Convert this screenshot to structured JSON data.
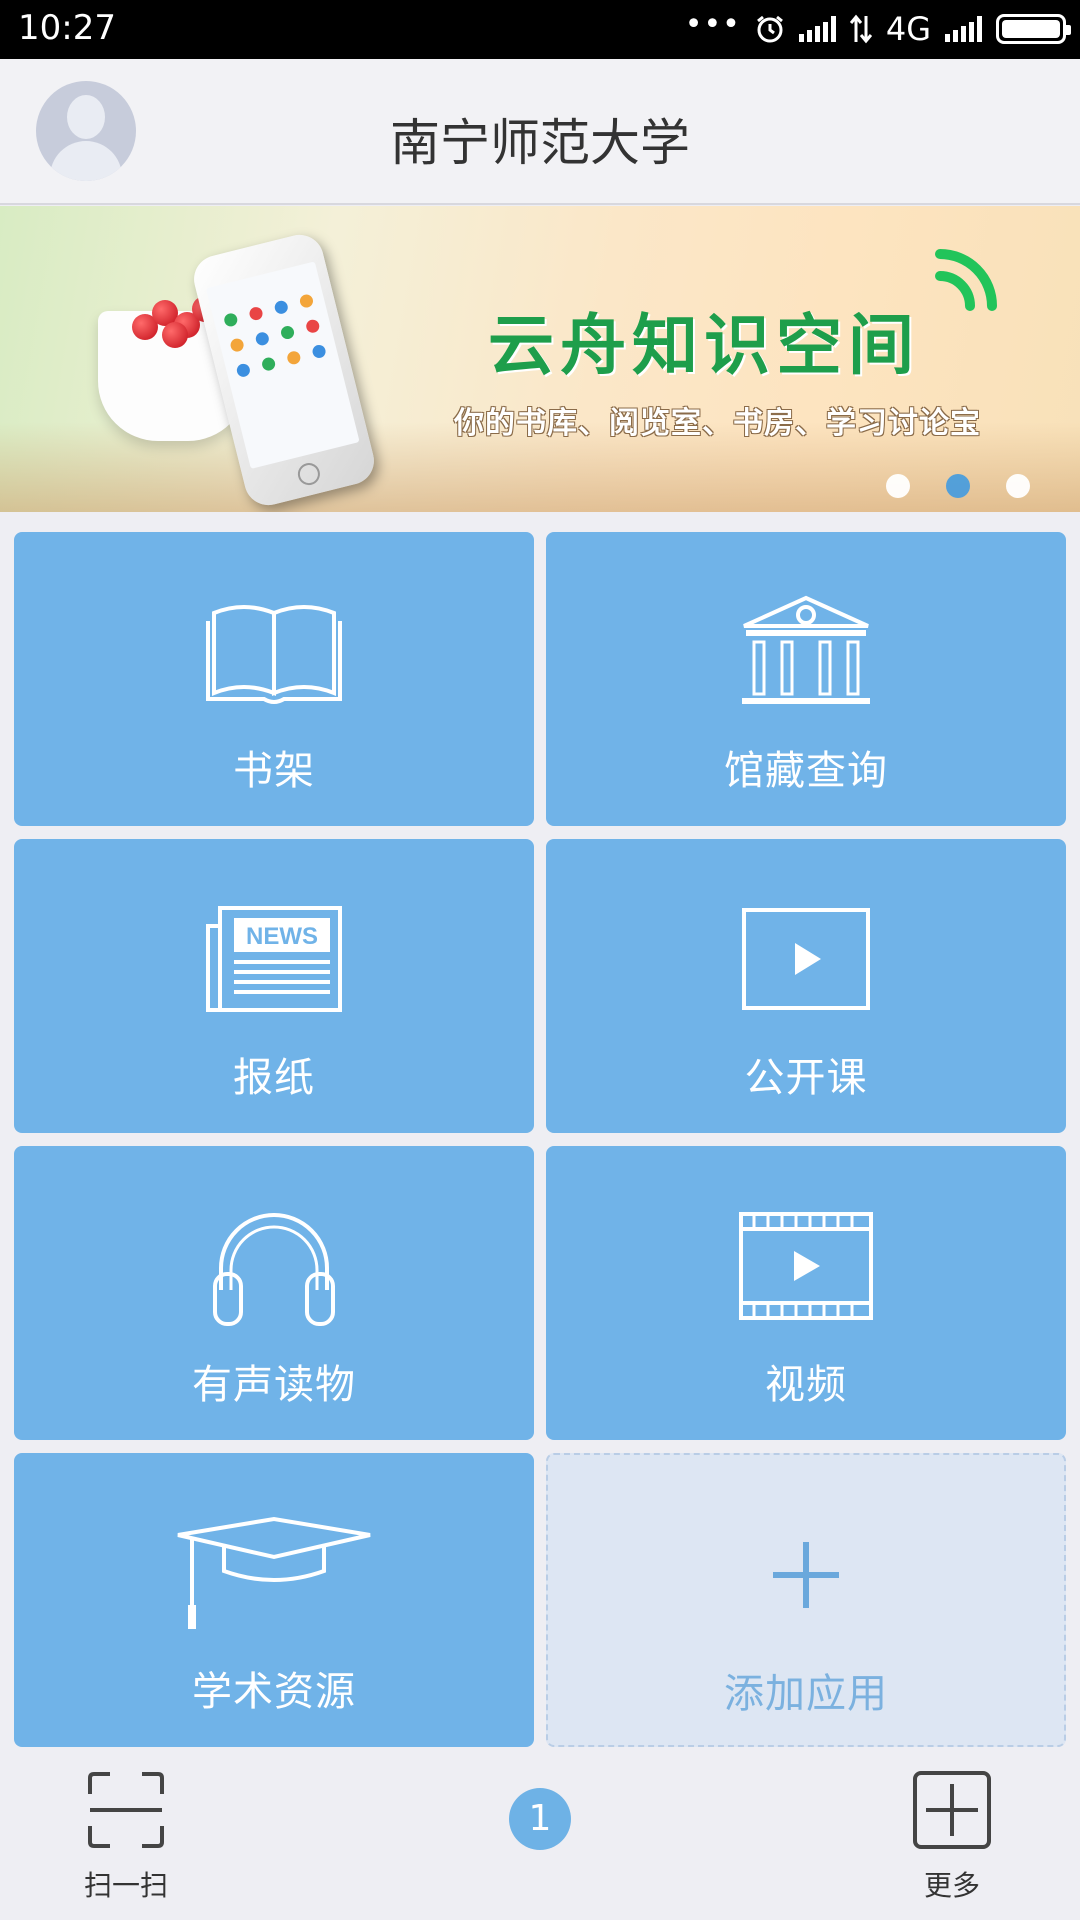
{
  "status_bar": {
    "time": "10:27",
    "network": "4G",
    "icons": [
      "more-dots-icon",
      "alarm-icon",
      "signal-icon",
      "data-transfer-icon",
      "signal-icon",
      "battery-icon"
    ]
  },
  "header": {
    "title": "南宁师范大学",
    "avatar_icon": "user-avatar-icon"
  },
  "banner": {
    "headline": "云舟知识空间",
    "subline": "你的书库、阅览室、书房、学习讨论宝",
    "pager": {
      "count": 3,
      "active_index": 1
    },
    "colors": {
      "headline": "#1e9e4b",
      "active_dot": "#4b9ddc"
    }
  },
  "tiles": [
    {
      "label": "书架",
      "icon": "book-icon"
    },
    {
      "label": "馆藏查询",
      "icon": "library-building-icon"
    },
    {
      "label": "报纸",
      "icon": "newspaper-icon",
      "icon_text": "NEWS"
    },
    {
      "label": "公开课",
      "icon": "play-icon"
    },
    {
      "label": "有声读物",
      "icon": "headphones-icon"
    },
    {
      "label": "视频",
      "icon": "film-icon"
    },
    {
      "label": "学术资源",
      "icon": "graduation-cap-icon"
    },
    {
      "label": "添加应用",
      "icon": "plus-icon"
    }
  ],
  "bottom_bar": {
    "scan_label": "扫一扫",
    "page_number": "1",
    "more_label": "更多"
  },
  "colors": {
    "tile": "#70b3e8",
    "add_tile": "#dde6f3",
    "background": "#eeeef3"
  }
}
